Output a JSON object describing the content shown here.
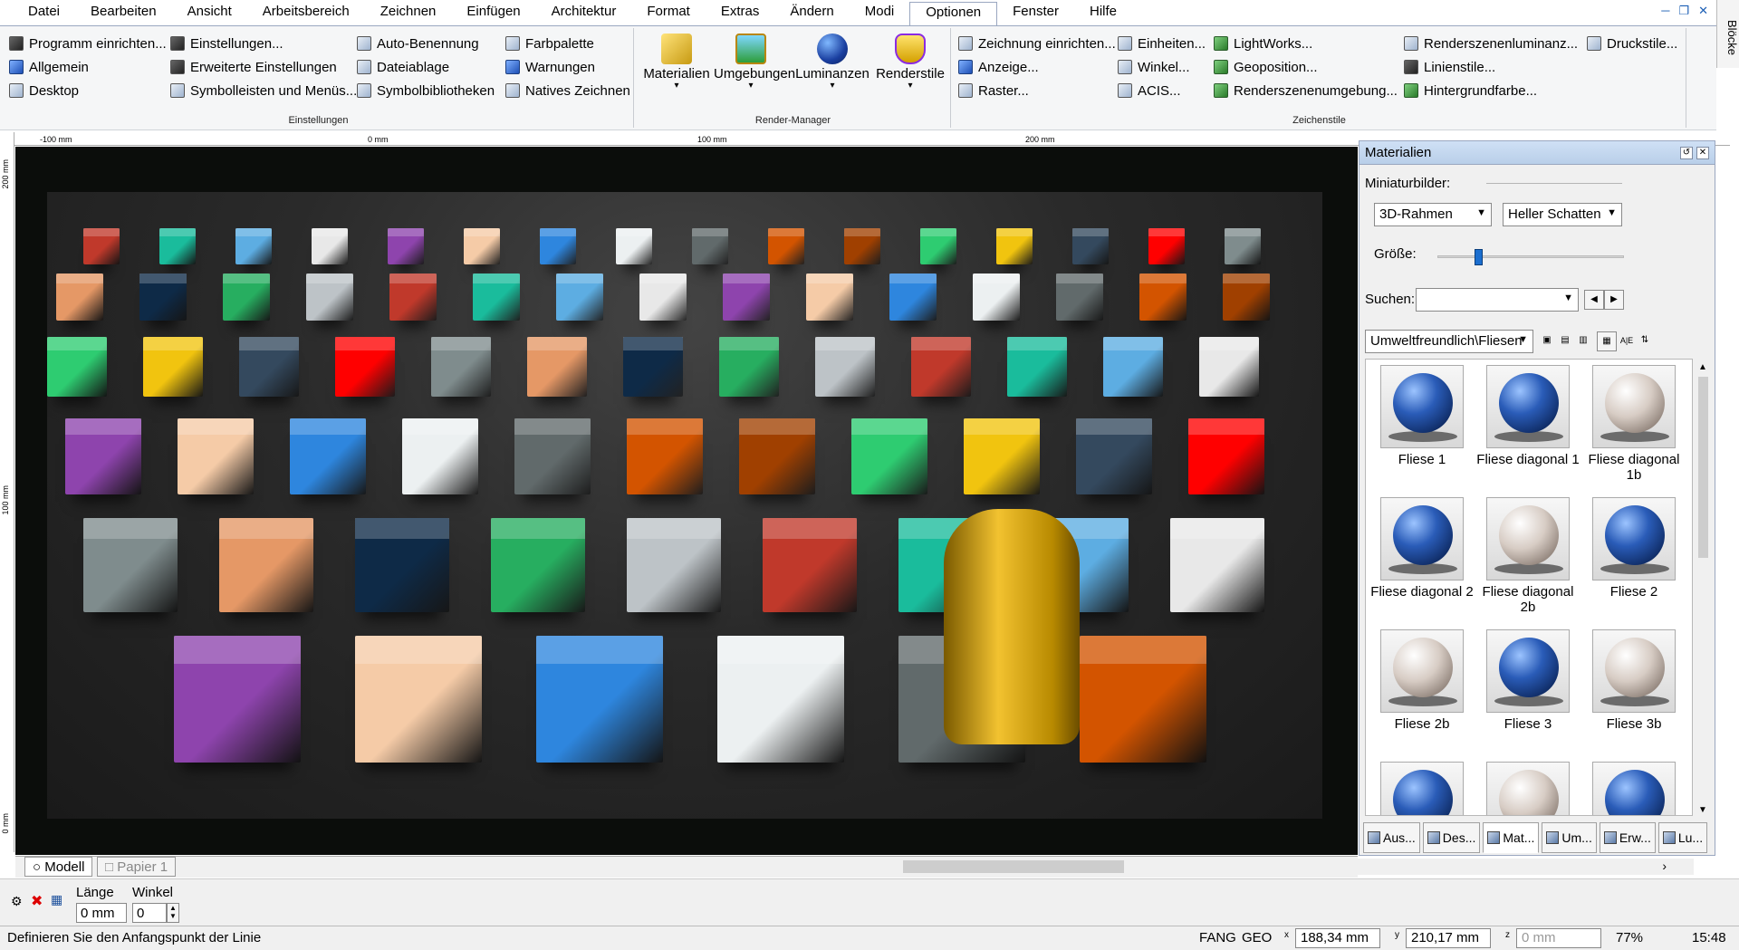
{
  "menu": [
    "Datei",
    "Bearbeiten",
    "Ansicht",
    "Arbeitsbereich",
    "Zeichnen",
    "Einfügen",
    "Architektur",
    "Format",
    "Extras",
    "Ändern",
    "Modi",
    "Optionen",
    "Fenster",
    "Hilfe"
  ],
  "menu_active": "Optionen",
  "side_tab": "Blöcke",
  "ribbon": {
    "einstellungen": {
      "title": "Einstellungen",
      "col1": [
        "Programm einrichten...",
        "Allgemein",
        "Desktop"
      ],
      "col2": [
        "Einstellungen...",
        "Erweiterte Einstellungen",
        "Symbolleisten und Menüs..."
      ],
      "col3": [
        "Auto-Benennung",
        "Dateiablage",
        "Symbolbibliotheken"
      ],
      "col4": [
        "Farbpalette",
        "Warnungen",
        "Natives Zeichnen"
      ]
    },
    "render": {
      "title": "Render-Manager",
      "buttons": [
        "Materialien",
        "Umgebungen",
        "Luminanzen",
        "Renderstile"
      ]
    },
    "zeichenstile": {
      "title": "Zeichenstile",
      "col1": [
        "Zeichnung einrichten...",
        "Anzeige...",
        "Raster..."
      ],
      "col2": [
        "Einheiten...",
        "Winkel...",
        "ACIS..."
      ],
      "col3": [
        "LightWorks...",
        "Geoposition...",
        "Renderszenenumgebung..."
      ],
      "col4": [
        "Renderszenenluminanz...",
        "Linienstile...",
        "Hintergrundfarbe..."
      ],
      "col5": [
        "Druckstile..."
      ]
    }
  },
  "ruler": {
    "top": [
      "-100 mm",
      "0 mm",
      "100 mm",
      "200 mm"
    ],
    "left": [
      "200 mm",
      "100 mm",
      "0 mm"
    ]
  },
  "materials_panel": {
    "title": "Materialien",
    "thumbnails_label": "Miniaturbilder:",
    "frame_select": "3D-Rahmen",
    "shadow_select": "Heller Schatten",
    "size_label": "Größe:",
    "size_value": 0.2,
    "search_label": "Suchen:",
    "search_value": "",
    "category": "Umweltfreundlich\\Fliesen",
    "items": [
      {
        "name": "Fliese 1",
        "color": "blue"
      },
      {
        "name": "Fliese diagonal 1",
        "color": "blue"
      },
      {
        "name": "Fliese diagonal 1b",
        "color": "white"
      },
      {
        "name": "Fliese diagonal 2",
        "color": "blue"
      },
      {
        "name": "Fliese diagonal 2b",
        "color": "white"
      },
      {
        "name": "Fliese 2",
        "color": "blue"
      },
      {
        "name": "Fliese 2b",
        "color": "white"
      },
      {
        "name": "Fliese 3",
        "color": "blue"
      },
      {
        "name": "Fliese 3b",
        "color": "white"
      },
      {
        "name": "",
        "color": "blue"
      },
      {
        "name": "",
        "color": "white"
      },
      {
        "name": "",
        "color": "blue"
      }
    ],
    "tabs": [
      "Aus...",
      "Des...",
      "Mat...",
      "Um...",
      "Erw...",
      "Lu..."
    ],
    "active_tab": "Mat..."
  },
  "sheets": [
    "Modell",
    "Papier 1"
  ],
  "input": {
    "length_label": "Länge",
    "length_value": "0 mm",
    "angle_label": "Winkel",
    "angle_value": "0"
  },
  "status": {
    "prompt": "Definieren Sie den Anfangspunkt der Linie",
    "fang": "FANG",
    "geo": "GEO",
    "x": "188,34 mm",
    "y": "210,17 mm",
    "z": "0 mm",
    "zoom": "77%",
    "time": "15:48"
  },
  "colors": {
    "accent": "#1b6ecf",
    "ribbon_bg": "#f5f6f7",
    "viewport_bg": "#0b0d0b"
  }
}
